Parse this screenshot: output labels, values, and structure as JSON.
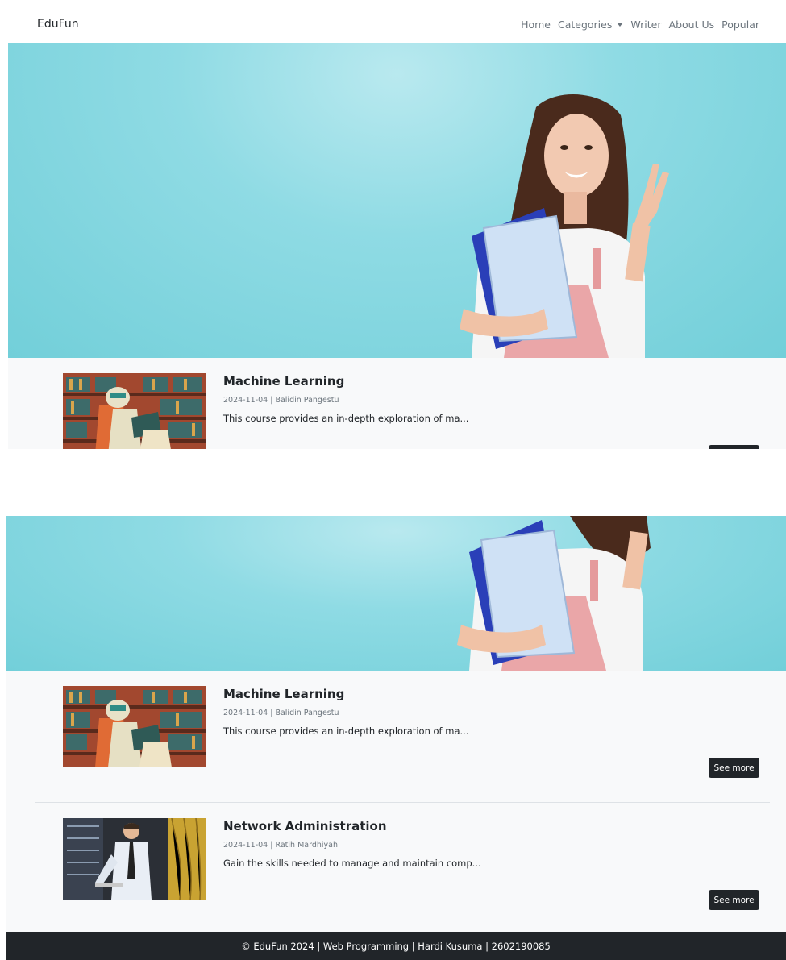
{
  "nav": {
    "brand": "EduFun",
    "links": [
      "Home",
      "Categories",
      "Writer",
      "About Us",
      "Popular"
    ]
  },
  "courses": [
    {
      "title": "Machine Learning",
      "meta": "2024-11-04 | Balidin Pangestu",
      "description": "This course provides an in-depth exploration of ma...",
      "button": "See more",
      "thumbnail": "robot-reading-in-library-image"
    },
    {
      "title": "Network Administration",
      "meta": "2024-11-04 | Ratih Mardhiyah",
      "description": "Gain the skills needed to manage and maintain comp...",
      "button": "See more",
      "thumbnail": "man-in-server-room-image"
    }
  ],
  "footer": {
    "text": "© EduFun 2024 | Web Programming | Hardi Kusuma | 2602190085"
  },
  "colors": {
    "hero_bg": "#8fdbe4",
    "dark": "#212529",
    "light_bg": "#f8f9fa",
    "muted": "#6c757d"
  }
}
